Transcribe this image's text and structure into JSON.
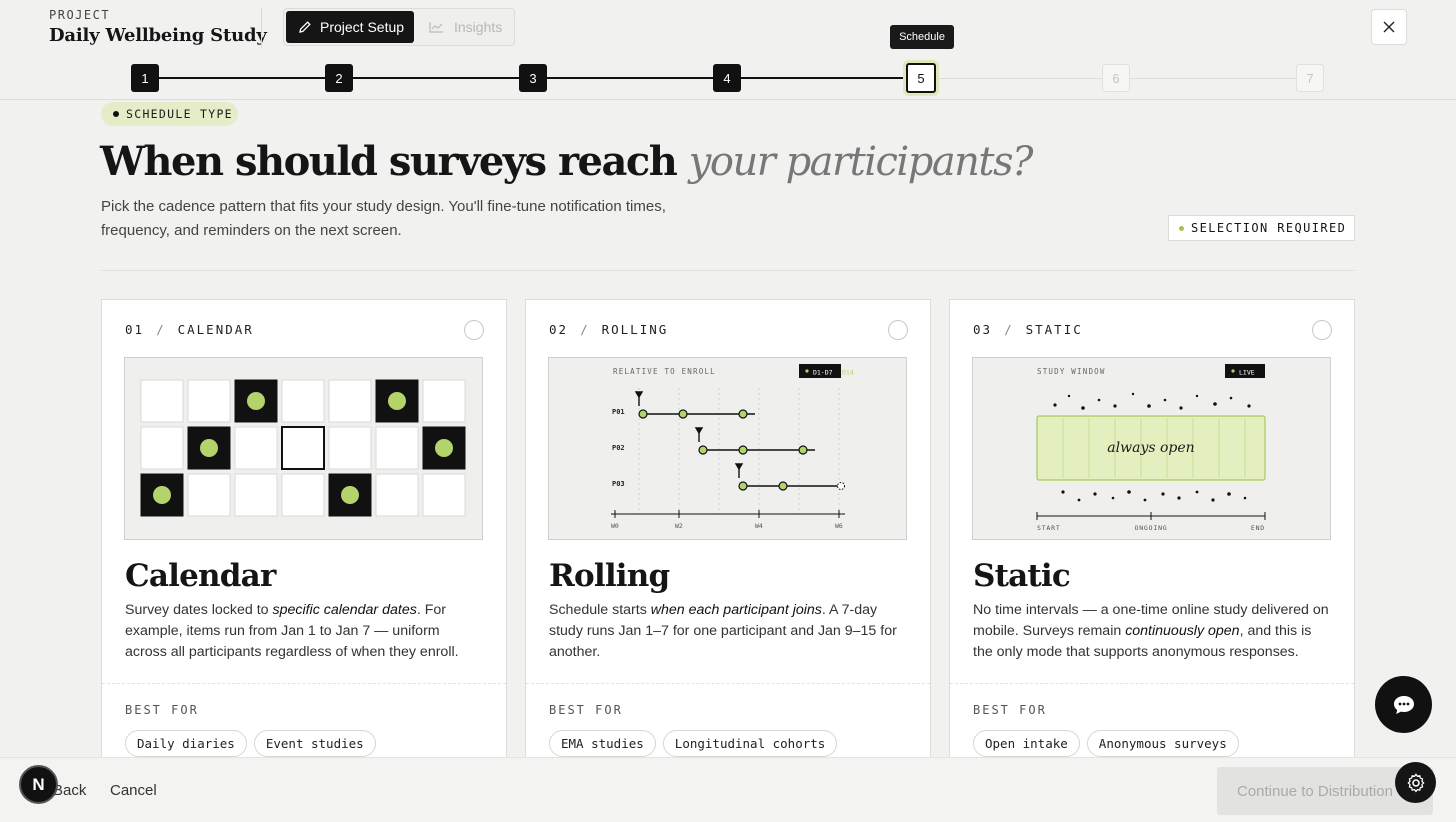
{
  "header": {
    "project_label": "PROJECT",
    "project_title": "Daily Wellbeing Study",
    "tabs": [
      {
        "label": "Project Setup"
      },
      {
        "label": "Insights"
      }
    ]
  },
  "stepper": {
    "tooltip": "Schedule",
    "steps": [
      {
        "number": "1",
        "state": "done"
      },
      {
        "number": "2",
        "state": "done"
      },
      {
        "number": "3",
        "state": "done"
      },
      {
        "number": "4",
        "state": "done"
      },
      {
        "number": "5",
        "state": "current"
      },
      {
        "number": "6",
        "state": "todo"
      },
      {
        "number": "7",
        "state": "todo"
      }
    ]
  },
  "hero": {
    "section_label": "SCHEDULE TYPE",
    "headline_main": "When should surveys reach",
    "headline_italic": "your participants?",
    "subtext": "Pick the cadence pattern that fits your study design. You'll fine-tune notification times, frequency, and reminders on the next screen.",
    "selection_required": "SELECTION REQUIRED"
  },
  "cards": [
    {
      "num": "01",
      "kind": "CALENDAR",
      "title": "Calendar",
      "desc_before": "Survey dates locked to ",
      "desc_em": "specific calendar dates",
      "desc_after": ". For example, items run from Jan 1 to Jan 7 — uniform across all participants regardless of when they enroll.",
      "bestfor_label": "BEST FOR",
      "tags": [
        "Daily diaries",
        "Event studies"
      ]
    },
    {
      "num": "02",
      "kind": "ROLLING",
      "title": "Rolling",
      "desc_before": "Schedule starts ",
      "desc_em": "when each participant joins",
      "desc_after": ". A 7-day study runs Jan 1–7 for one participant and Jan 9–15 for another.",
      "bestfor_label": "BEST FOR",
      "tags": [
        "EMA studies",
        "Longitudinal cohorts"
      ],
      "illus": {
        "caption": "RELATIVE TO ENROLL",
        "badge_a": "D1·D7",
        "badge_b": "D14",
        "rows": [
          "P01",
          "P02",
          "P03"
        ],
        "ticks": [
          "W0",
          "W2",
          "W4",
          "W6"
        ]
      }
    },
    {
      "num": "03",
      "kind": "STATIC",
      "title": "Static",
      "desc_before": "No time intervals — a one-time online study delivered on mobile. Surveys remain ",
      "desc_em": "continuously open",
      "desc_after": ", and this is the only mode that supports anonymous responses.",
      "bestfor_label": "BEST FOR",
      "tags": [
        "Open intake",
        "Anonymous surveys"
      ],
      "illus": {
        "caption": "STUDY WINDOW",
        "badge": "LIVE",
        "center_text": "always open",
        "ticks": [
          "START",
          "ONGOING",
          "END"
        ]
      }
    }
  ],
  "footer": {
    "back": "Back",
    "cancel": "Cancel",
    "continue": "Continue to Distribution",
    "avatar_letter": "N"
  },
  "colors": {
    "accent_green": "#b4d36a",
    "dark": "#111111",
    "pill_bg": "#e4ecc8"
  }
}
